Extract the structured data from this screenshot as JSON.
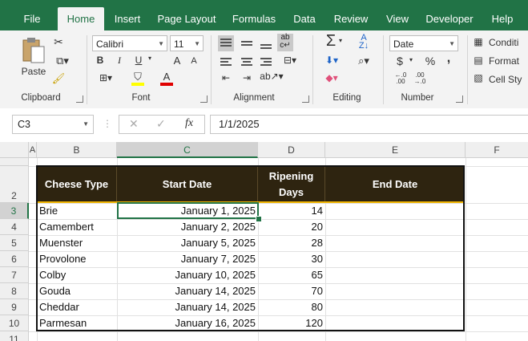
{
  "tabs": [
    "File",
    "Home",
    "Insert",
    "Page Layout",
    "Formulas",
    "Data",
    "Review",
    "View",
    "Developer",
    "Help"
  ],
  "active_tab": "Home",
  "ribbon": {
    "clipboard": {
      "paste_label": "Paste",
      "group_label": "Clipboard"
    },
    "font": {
      "font_name": "Calibri",
      "font_size": "11",
      "group_label": "Font",
      "bold": "B",
      "italic": "I",
      "underline": "U",
      "grow": "A",
      "shrink": "A"
    },
    "alignment": {
      "group_label": "Alignment"
    },
    "editing": {
      "group_label": "Editing"
    },
    "number": {
      "format": "Date",
      "currency": "$",
      "percent": "%",
      "comma": ",",
      "group_label": "Number"
    },
    "styles": {
      "conditional": "Conditi",
      "format_as": "Format",
      "cell_styles": "Cell Sty"
    }
  },
  "formula_bar": {
    "name_box": "C3",
    "formula": "1/1/2025",
    "fx": "fx"
  },
  "columns": [
    "A",
    "B",
    "C",
    "D",
    "E",
    "F"
  ],
  "rows": [
    "2",
    "3",
    "4",
    "5",
    "6",
    "7",
    "8",
    "9",
    "10",
    "11"
  ],
  "table": {
    "headers": [
      "Cheese Type",
      "Start Date",
      "Ripening Days",
      "End Date"
    ],
    "rows": [
      [
        "Brie",
        "January 1, 2025",
        "14",
        ""
      ],
      [
        "Camembert",
        "January 2, 2025",
        "20",
        ""
      ],
      [
        "Muenster",
        "January 5, 2025",
        "28",
        ""
      ],
      [
        "Provolone",
        "January 7, 2025",
        "30",
        ""
      ],
      [
        "Colby",
        "January 10, 2025",
        "65",
        ""
      ],
      [
        "Gouda",
        "January 14, 2025",
        "70",
        ""
      ],
      [
        "Cheddar",
        "January 14, 2025",
        "80",
        ""
      ],
      [
        "Parmesan",
        "January 16, 2025",
        "120",
        ""
      ]
    ]
  },
  "colors": {
    "excel_green": "#217346",
    "header_fill": "#2e2410",
    "accent_gold": "#f0b400"
  }
}
